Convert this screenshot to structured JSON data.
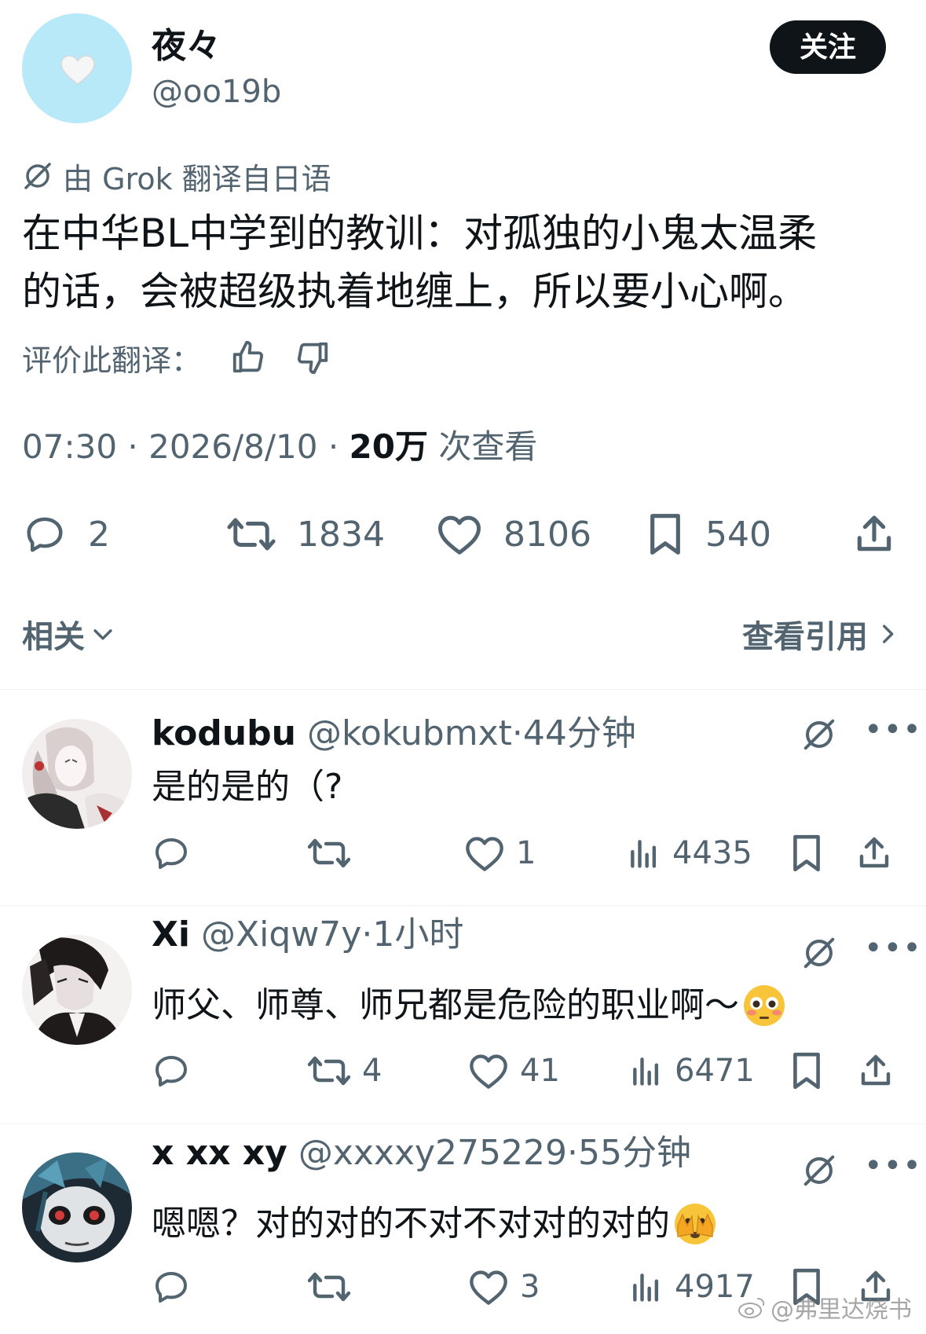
{
  "tweet": {
    "author_name": "夜々",
    "author_handle": "@oo19b",
    "follow_label": "关注",
    "translation_note": "由 Grok 翻译自日语",
    "text_line1": "在中华BL中学到的教训：对孤独的小鬼太温柔",
    "text_line2": "的话，会被超级执着地缠上，所以要小心啊。",
    "rate_label": "评价此翻译：",
    "time": "07:30",
    "date": "2026/8/10",
    "views_count": "20万",
    "views_label": "次查看",
    "replies": "2",
    "retweets": "1834",
    "likes": "8106",
    "bookmarks": "540"
  },
  "related_label": "相关",
  "quotes_label": "查看引用",
  "replies": [
    {
      "name": "kodubu",
      "handle": "@kokubmxt",
      "time": "44分钟",
      "text": "是的是的（?",
      "emoji": "",
      "retweets": "",
      "likes": "1",
      "views": "4435"
    },
    {
      "name": "Xi",
      "handle": "@Xiqw7y",
      "time": "1小时",
      "text": "师父、师尊、师兄都是危险的职业啊～",
      "emoji": "flushed-face",
      "retweets": "4",
      "likes": "41",
      "views": "6471"
    },
    {
      "name": "x xx xy",
      "handle": "@xxxxy275229",
      "time": "55分钟",
      "text": "嗯嗯？对的对的不对不对对的对的",
      "emoji": "face-peeking",
      "retweets": "",
      "likes": "3",
      "views": "4917"
    }
  ],
  "watermark": "@弗里达烧书",
  "colors": {
    "text": "#0f1419",
    "secondary": "#536471",
    "divider": "#eff3f4",
    "avatar_bg": "#b7e9f9"
  }
}
